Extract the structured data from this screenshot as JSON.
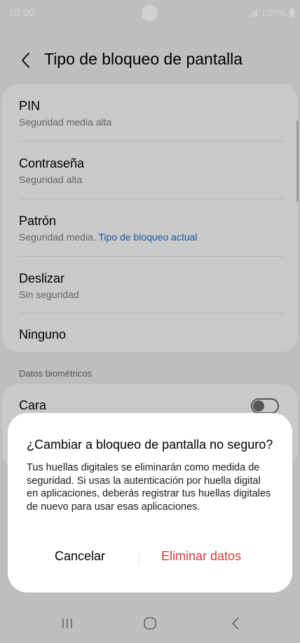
{
  "status_bar": {
    "time": "10:00",
    "battery": "100%",
    "icons": [
      "signal-icon",
      "battery-icon"
    ]
  },
  "header": {
    "title": "Tipo de bloqueo de pantalla",
    "back_icon": "back-arrow-icon"
  },
  "lock_options": [
    {
      "title": "PIN",
      "subtitle": "Seguridad media alta"
    },
    {
      "title": "Contraseña",
      "subtitle": "Seguridad alta"
    },
    {
      "title": "Patrón",
      "subtitle": "Seguridad media,",
      "current_label": "Tipo de bloqueo actual"
    },
    {
      "title": "Deslizar",
      "subtitle": "Sin seguridad"
    },
    {
      "title": "Ninguno"
    }
  ],
  "biometrics": {
    "section_title": "Datos biométricos",
    "items": [
      {
        "label": "Cara",
        "enabled": false
      }
    ]
  },
  "dialog": {
    "title": "¿Cambiar a bloqueo de pantalla no seguro?",
    "body": "Tus huellas digitales se eliminarán como medida de seguridad. Si usas la autenticación por huella digital en aplicaciones, deberás registrar tus huellas digitales de nuevo para usar esas aplicaciones.",
    "cancel_label": "Cancelar",
    "confirm_label": "Eliminar datos"
  },
  "colors": {
    "accent_link": "#1a6fc4",
    "destructive": "#cf3b37",
    "background": "#e8e8e8",
    "card": "#f6f6f6"
  },
  "nav_bar": {
    "icons": [
      "recent-apps-icon",
      "home-icon",
      "back-icon"
    ]
  }
}
